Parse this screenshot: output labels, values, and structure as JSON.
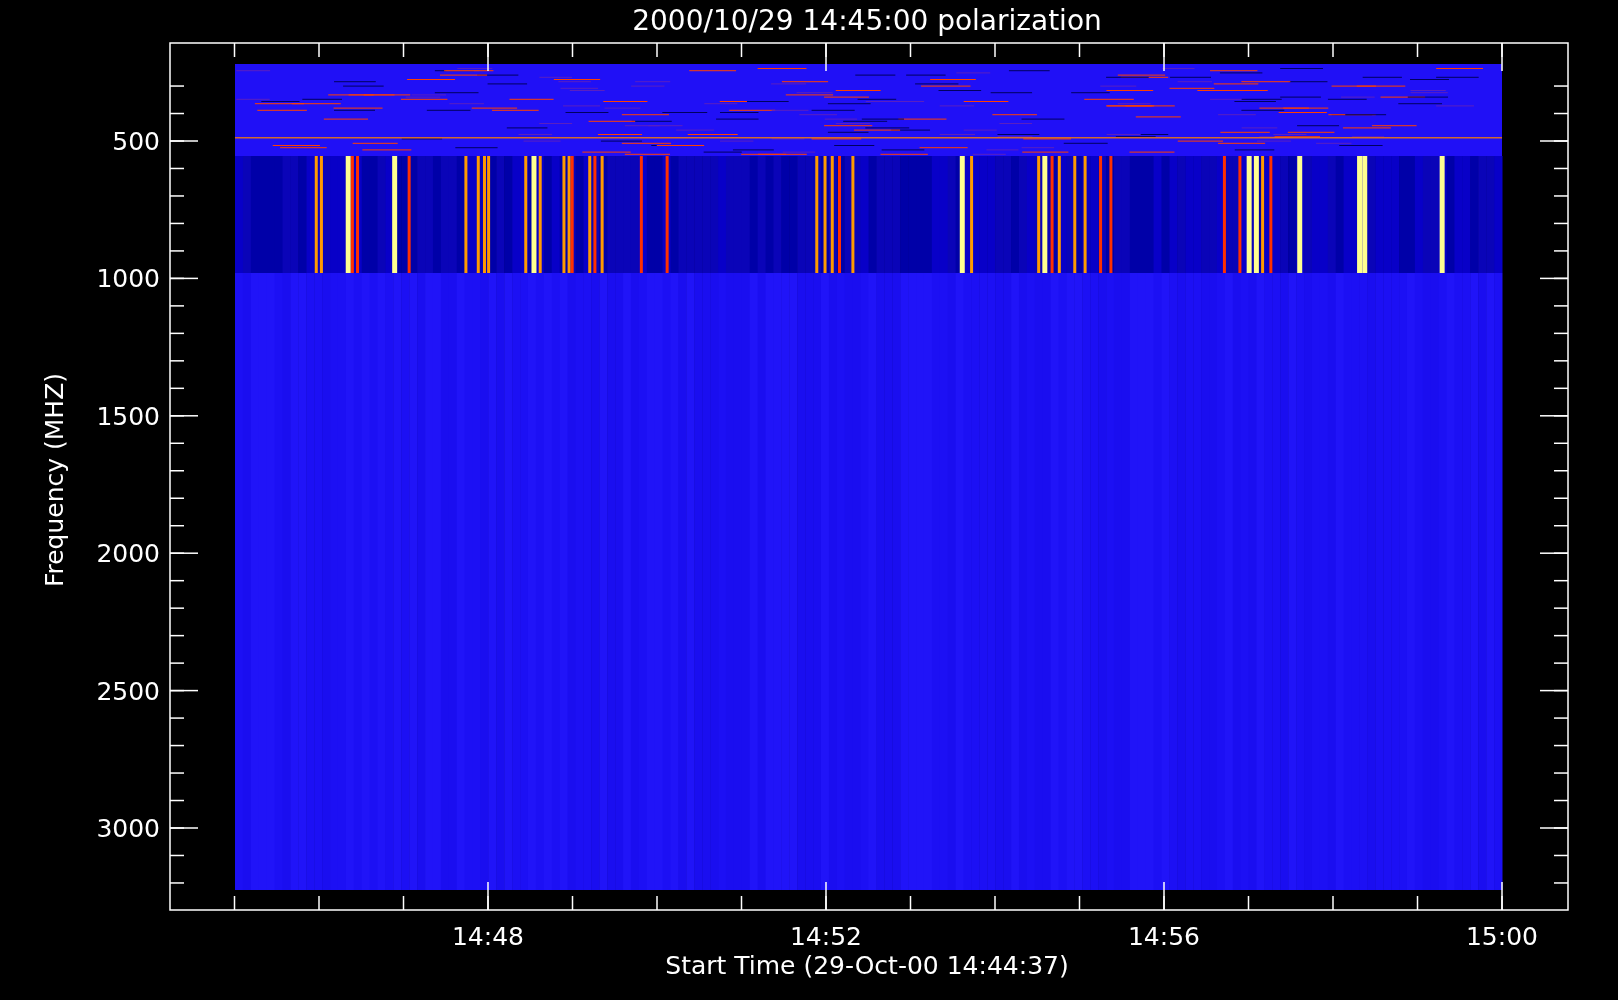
{
  "title": "2000/10/29 14:45:00 polarization",
  "y_axis": {
    "label": "Frequency (MHZ)",
    "ticks": [
      "500",
      "1000",
      "1500",
      "2000",
      "2500",
      "3000"
    ]
  },
  "x_axis": {
    "label": "Start Time (29-Oct-00 14:44:37)",
    "ticks": [
      "14:48",
      "14:52",
      "14:56",
      "15:00"
    ]
  }
}
